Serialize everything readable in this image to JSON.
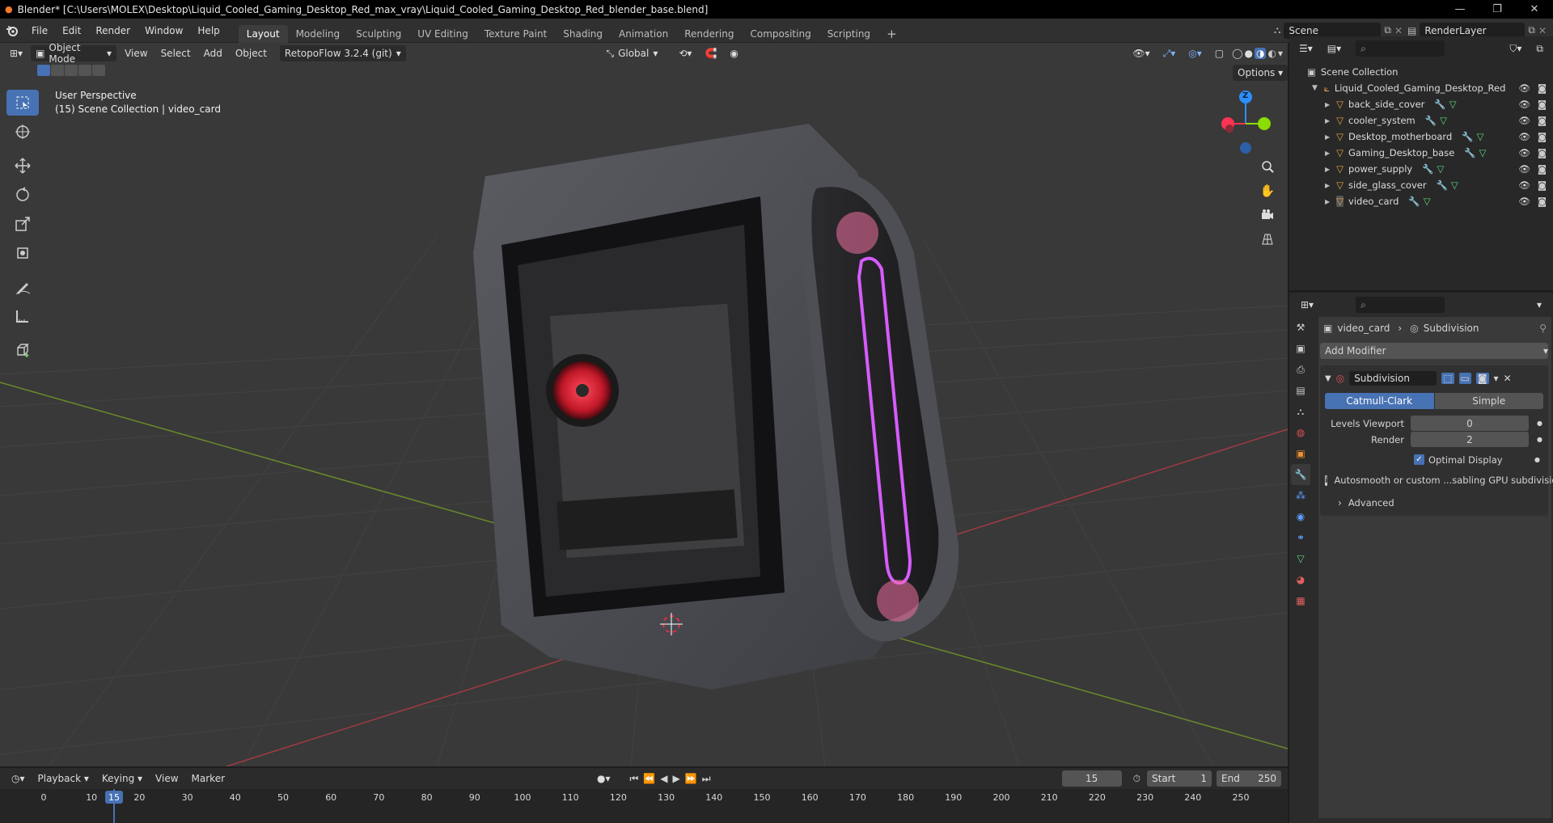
{
  "window": {
    "title": "Blender* [C:\\Users\\MOLEX\\Desktop\\Liquid_Cooled_Gaming_Desktop_Red_max_vray\\Liquid_Cooled_Gaming_Desktop_Red_blender_base.blend]"
  },
  "menu": {
    "items": [
      "File",
      "Edit",
      "Render",
      "Window",
      "Help"
    ]
  },
  "workspaces": [
    "Layout",
    "Modeling",
    "Sculpting",
    "UV Editing",
    "Texture Paint",
    "Shading",
    "Animation",
    "Rendering",
    "Compositing",
    "Scripting"
  ],
  "scene": {
    "name": "Scene",
    "view_layer": "RenderLayer"
  },
  "viewport": {
    "mode": "Object Mode",
    "menus": [
      "View",
      "Select",
      "Add",
      "Object"
    ],
    "addon": "RetopoFlow 3.2.4 (git)",
    "orientation": "Global",
    "options_label": "Options",
    "overlay_line1": "User Perspective",
    "overlay_line2": "(15) Scene Collection | video_card",
    "gizmo": {
      "z": "Z"
    }
  },
  "outliner": {
    "root": "Scene Collection",
    "collection": "Liquid_Cooled_Gaming_Desktop_Red",
    "objects": [
      "back_side_cover",
      "cooler_system",
      "Desktop_motherboard",
      "Gaming_Desktop_base",
      "power_supply",
      "side_glass_cover",
      "video_card"
    ]
  },
  "properties": {
    "breadcrumb_object": "video_card",
    "breadcrumb_modifier": "Subdivision",
    "add_modifier": "Add Modifier",
    "modifier_name": "Subdivision",
    "type_catmull": "Catmull-Clark",
    "type_simple": "Simple",
    "levels_viewport_label": "Levels Viewport",
    "levels_viewport_value": "0",
    "render_label": "Render",
    "render_value": "2",
    "optimal_display": "Optimal Display",
    "info": "Autosmooth or custom ...sabling GPU subdivision",
    "advanced": "Advanced"
  },
  "timeline": {
    "menus": [
      "Playback",
      "Keying",
      "View",
      "Marker"
    ],
    "current_frame": "15",
    "start_label": "Start",
    "start_value": "1",
    "end_label": "End",
    "end_value": "250",
    "ticks": [
      "0",
      "10",
      "20",
      "30",
      "40",
      "50",
      "60",
      "70",
      "80",
      "90",
      "100",
      "110",
      "120",
      "130",
      "140",
      "150",
      "160",
      "170",
      "180",
      "190",
      "200",
      "210",
      "220",
      "230",
      "240",
      "250"
    ],
    "playhead": "15"
  },
  "colors": {
    "accent": "#4772b3",
    "x_axis": "#ff3352",
    "y_axis": "#8bdc00",
    "z_axis": "#2c8fff",
    "active_tool": "#4772b3"
  }
}
